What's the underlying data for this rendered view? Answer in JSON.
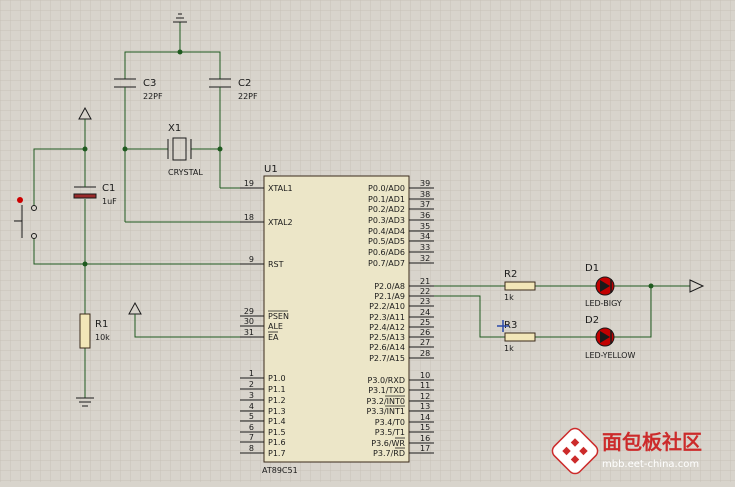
{
  "colors": {
    "background": "#d8d4cc",
    "grid": "#c7c2b8",
    "wire": "#1f5a1f",
    "led": "#c20000",
    "chip_fill": "#ece6c8",
    "watermark_red": "#cc2b2b"
  },
  "components": {
    "c3": {
      "ref": "C3",
      "value": "22PF"
    },
    "c2": {
      "ref": "C2",
      "value": "22PF"
    },
    "x1": {
      "ref": "X1",
      "value": "CRYSTAL"
    },
    "c1": {
      "ref": "C1",
      "value": "1uF"
    },
    "r1": {
      "ref": "R1",
      "value": "10k"
    },
    "r2": {
      "ref": "R2",
      "value": "1k"
    },
    "r3": {
      "ref": "R3",
      "value": "1k"
    },
    "d1": {
      "ref": "D1",
      "value": "LED-BIGY"
    },
    "d2": {
      "ref": "D2",
      "value": "LED-YELLOW"
    }
  },
  "chip": {
    "ref": "U1",
    "part": "AT89C51",
    "left_pins": [
      {
        "num": "19",
        "name": "XTAL1"
      },
      {
        "num": "18",
        "name": "XTAL2"
      },
      {
        "num": "9",
        "name": "RST"
      },
      {
        "num": "29",
        "name": "PSEN"
      },
      {
        "num": "30",
        "name": "ALE"
      },
      {
        "num": "31",
        "name": "EA"
      },
      {
        "num": "1",
        "name": "P1.0"
      },
      {
        "num": "2",
        "name": "P1.1"
      },
      {
        "num": "3",
        "name": "P1.2"
      },
      {
        "num": "4",
        "name": "P1.3"
      },
      {
        "num": "5",
        "name": "P1.4"
      },
      {
        "num": "6",
        "name": "P1.5"
      },
      {
        "num": "7",
        "name": "P1.6"
      },
      {
        "num": "8",
        "name": "P1.7"
      }
    ],
    "right_pins": [
      {
        "num": "39",
        "name": "P0.0/AD0"
      },
      {
        "num": "38",
        "name": "P0.1/AD1"
      },
      {
        "num": "37",
        "name": "P0.2/AD2"
      },
      {
        "num": "36",
        "name": "P0.3/AD3"
      },
      {
        "num": "35",
        "name": "P0.4/AD4"
      },
      {
        "num": "34",
        "name": "P0.5/AD5"
      },
      {
        "num": "33",
        "name": "P0.6/AD6"
      },
      {
        "num": "32",
        "name": "P0.7/AD7"
      },
      {
        "num": "21",
        "name": "P2.0/A8"
      },
      {
        "num": "22",
        "name": "P2.1/A9"
      },
      {
        "num": "23",
        "name": "P2.2/A10"
      },
      {
        "num": "24",
        "name": "P2.3/A11"
      },
      {
        "num": "25",
        "name": "P2.4/A12"
      },
      {
        "num": "26",
        "name": "P2.5/A13"
      },
      {
        "num": "27",
        "name": "P2.6/A14"
      },
      {
        "num": "28",
        "name": "P2.7/A15"
      },
      {
        "num": "10",
        "name": "P3.0/RXD"
      },
      {
        "num": "11",
        "name": "P3.1/TXD"
      },
      {
        "num": "12",
        "name": "P3.2/INT0"
      },
      {
        "num": "13",
        "name": "P3.3/INT1"
      },
      {
        "num": "14",
        "name": "P3.4/T0"
      },
      {
        "num": "15",
        "name": "P3.5/T1"
      },
      {
        "num": "16",
        "name": "P3.6/WR"
      },
      {
        "num": "17",
        "name": "P3.7/RD"
      }
    ]
  },
  "watermark": {
    "brand": "面包板社区",
    "url": "mbb.eet-china.com"
  }
}
